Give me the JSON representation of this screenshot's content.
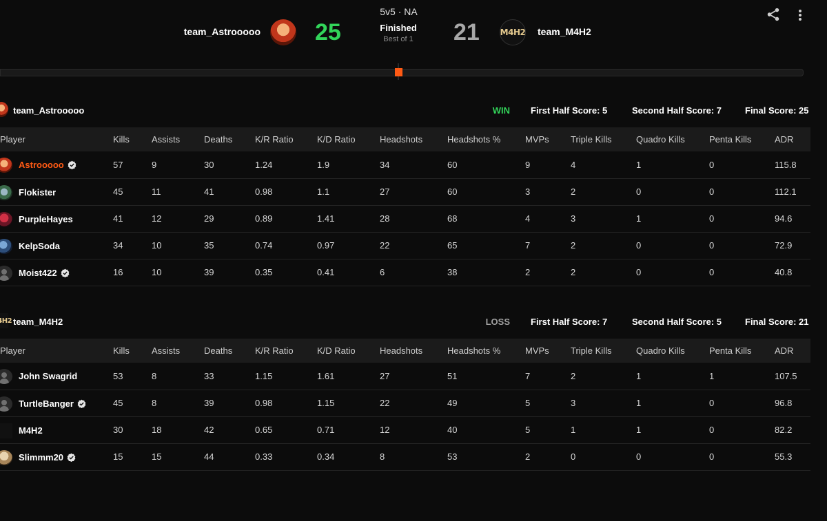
{
  "header": {
    "mode": "5v5 · NA",
    "status": "Finished",
    "best_of": "Best of 1",
    "team_left": {
      "name": "team_Astrooooo",
      "score": "25"
    },
    "team_right": {
      "name": "team_M4H2",
      "score": "21",
      "logo_text": "M4H2"
    }
  },
  "timeline": {
    "marker_color": "#ff5a14"
  },
  "colors": {
    "win": "#32d55a",
    "accent": "#ff5a14",
    "loss": "#a0a0a0"
  },
  "columns": [
    "Player",
    "Kills",
    "Assists",
    "Deaths",
    "K/R Ratio",
    "K/D Ratio",
    "Headshots",
    "Headshots %",
    "MVPs",
    "Triple Kills",
    "Quadro Kills",
    "Penta Kills",
    "ADR"
  ],
  "teams": [
    {
      "name": "team_Astrooooo",
      "result": "WIN",
      "first_half": "First Half Score: 5",
      "second_half": "Second Half Score: 7",
      "final": "Final Score: 25",
      "players": [
        {
          "name": "Astrooooo",
          "verified": true,
          "highlight": true,
          "avatar": "fire",
          "stats": [
            "57",
            "9",
            "30",
            "1.24",
            "1.9",
            "34",
            "60",
            "9",
            "4",
            "1",
            "0",
            "115.8"
          ]
        },
        {
          "name": "Flokister",
          "verified": false,
          "highlight": false,
          "avatar": "green",
          "stats": [
            "45",
            "11",
            "41",
            "0.98",
            "1.1",
            "27",
            "60",
            "3",
            "2",
            "0",
            "0",
            "112.1"
          ]
        },
        {
          "name": "PurpleHayes",
          "verified": false,
          "highlight": false,
          "avatar": "red",
          "stats": [
            "41",
            "12",
            "29",
            "0.89",
            "1.41",
            "28",
            "68",
            "4",
            "3",
            "1",
            "0",
            "94.6"
          ]
        },
        {
          "name": "KelpSoda",
          "verified": false,
          "highlight": false,
          "avatar": "blue",
          "stats": [
            "34",
            "10",
            "35",
            "0.74",
            "0.97",
            "22",
            "65",
            "7",
            "2",
            "0",
            "0",
            "72.9"
          ]
        },
        {
          "name": "Moist422",
          "verified": true,
          "highlight": false,
          "avatar": "default",
          "stats": [
            "16",
            "10",
            "39",
            "0.35",
            "0.41",
            "6",
            "38",
            "2",
            "2",
            "0",
            "0",
            "40.8"
          ]
        }
      ]
    },
    {
      "name": "team_M4H2",
      "result": "LOSS",
      "first_half": "First Half Score: 7",
      "second_half": "Second Half Score: 5",
      "final": "Final Score: 21",
      "players": [
        {
          "name": "John Swagrid",
          "verified": false,
          "highlight": false,
          "avatar": "default",
          "stats": [
            "53",
            "8",
            "33",
            "1.15",
            "1.61",
            "27",
            "51",
            "7",
            "2",
            "1",
            "1",
            "107.5"
          ]
        },
        {
          "name": "TurtleBanger",
          "verified": true,
          "highlight": false,
          "avatar": "default",
          "stats": [
            "45",
            "8",
            "39",
            "0.98",
            "1.15",
            "22",
            "49",
            "5",
            "3",
            "1",
            "0",
            "96.8"
          ]
        },
        {
          "name": "M4H2",
          "verified": false,
          "highlight": false,
          "avatar": "m4h2",
          "stats": [
            "30",
            "18",
            "42",
            "0.65",
            "0.71",
            "12",
            "40",
            "5",
            "1",
            "1",
            "0",
            "82.2"
          ]
        },
        {
          "name": "Slimmm20",
          "verified": true,
          "highlight": false,
          "avatar": "tan",
          "stats": [
            "15",
            "15",
            "44",
            "0.33",
            "0.34",
            "8",
            "53",
            "2",
            "0",
            "0",
            "0",
            "55.3"
          ]
        }
      ]
    }
  ]
}
